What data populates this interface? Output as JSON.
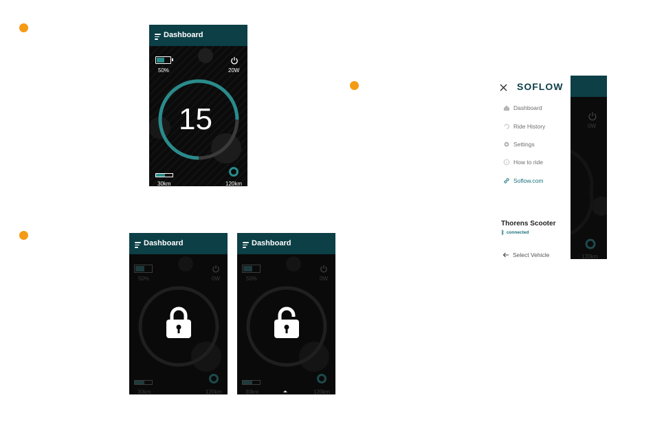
{
  "colors": {
    "accent": "#f59a14",
    "header": "#0c3f46",
    "teal": "#2a8b8b",
    "background_dark": "#0b0b0b"
  },
  "screen1": {
    "header_title": "Dashboard",
    "battery": "50%",
    "power": "20W",
    "speed": "15",
    "distance": "30km",
    "range": "120km",
    "battery_level": 0.5,
    "speed_progress": 0.5
  },
  "screen_locked": {
    "header_title": "Dashboard",
    "battery": "50%",
    "power": "0W",
    "distance": "30km",
    "range": "120km",
    "lock_icon": "lock-closed-icon"
  },
  "screen_unlocked": {
    "header_title": "Dashboard",
    "battery": "50%",
    "power": "0W",
    "distance": "30km",
    "range": "120km",
    "lock_icon": "lock-open-icon"
  },
  "drawer": {
    "brand": "SOFLOW",
    "items": [
      {
        "label": "Dashboard",
        "icon": "home-icon"
      },
      {
        "label": "Ride History",
        "icon": "history-icon"
      },
      {
        "label": "Settings",
        "icon": "gear-icon"
      },
      {
        "label": "How to ride",
        "icon": "info-icon"
      },
      {
        "label": "Soflow.com",
        "icon": "link-icon"
      }
    ],
    "vehicle_name": "Thorens Scooter",
    "vehicle_status": "connected",
    "select_vehicle": "Select Vehicle"
  },
  "drawer_behind": {
    "power": "0W",
    "range": "120km"
  }
}
